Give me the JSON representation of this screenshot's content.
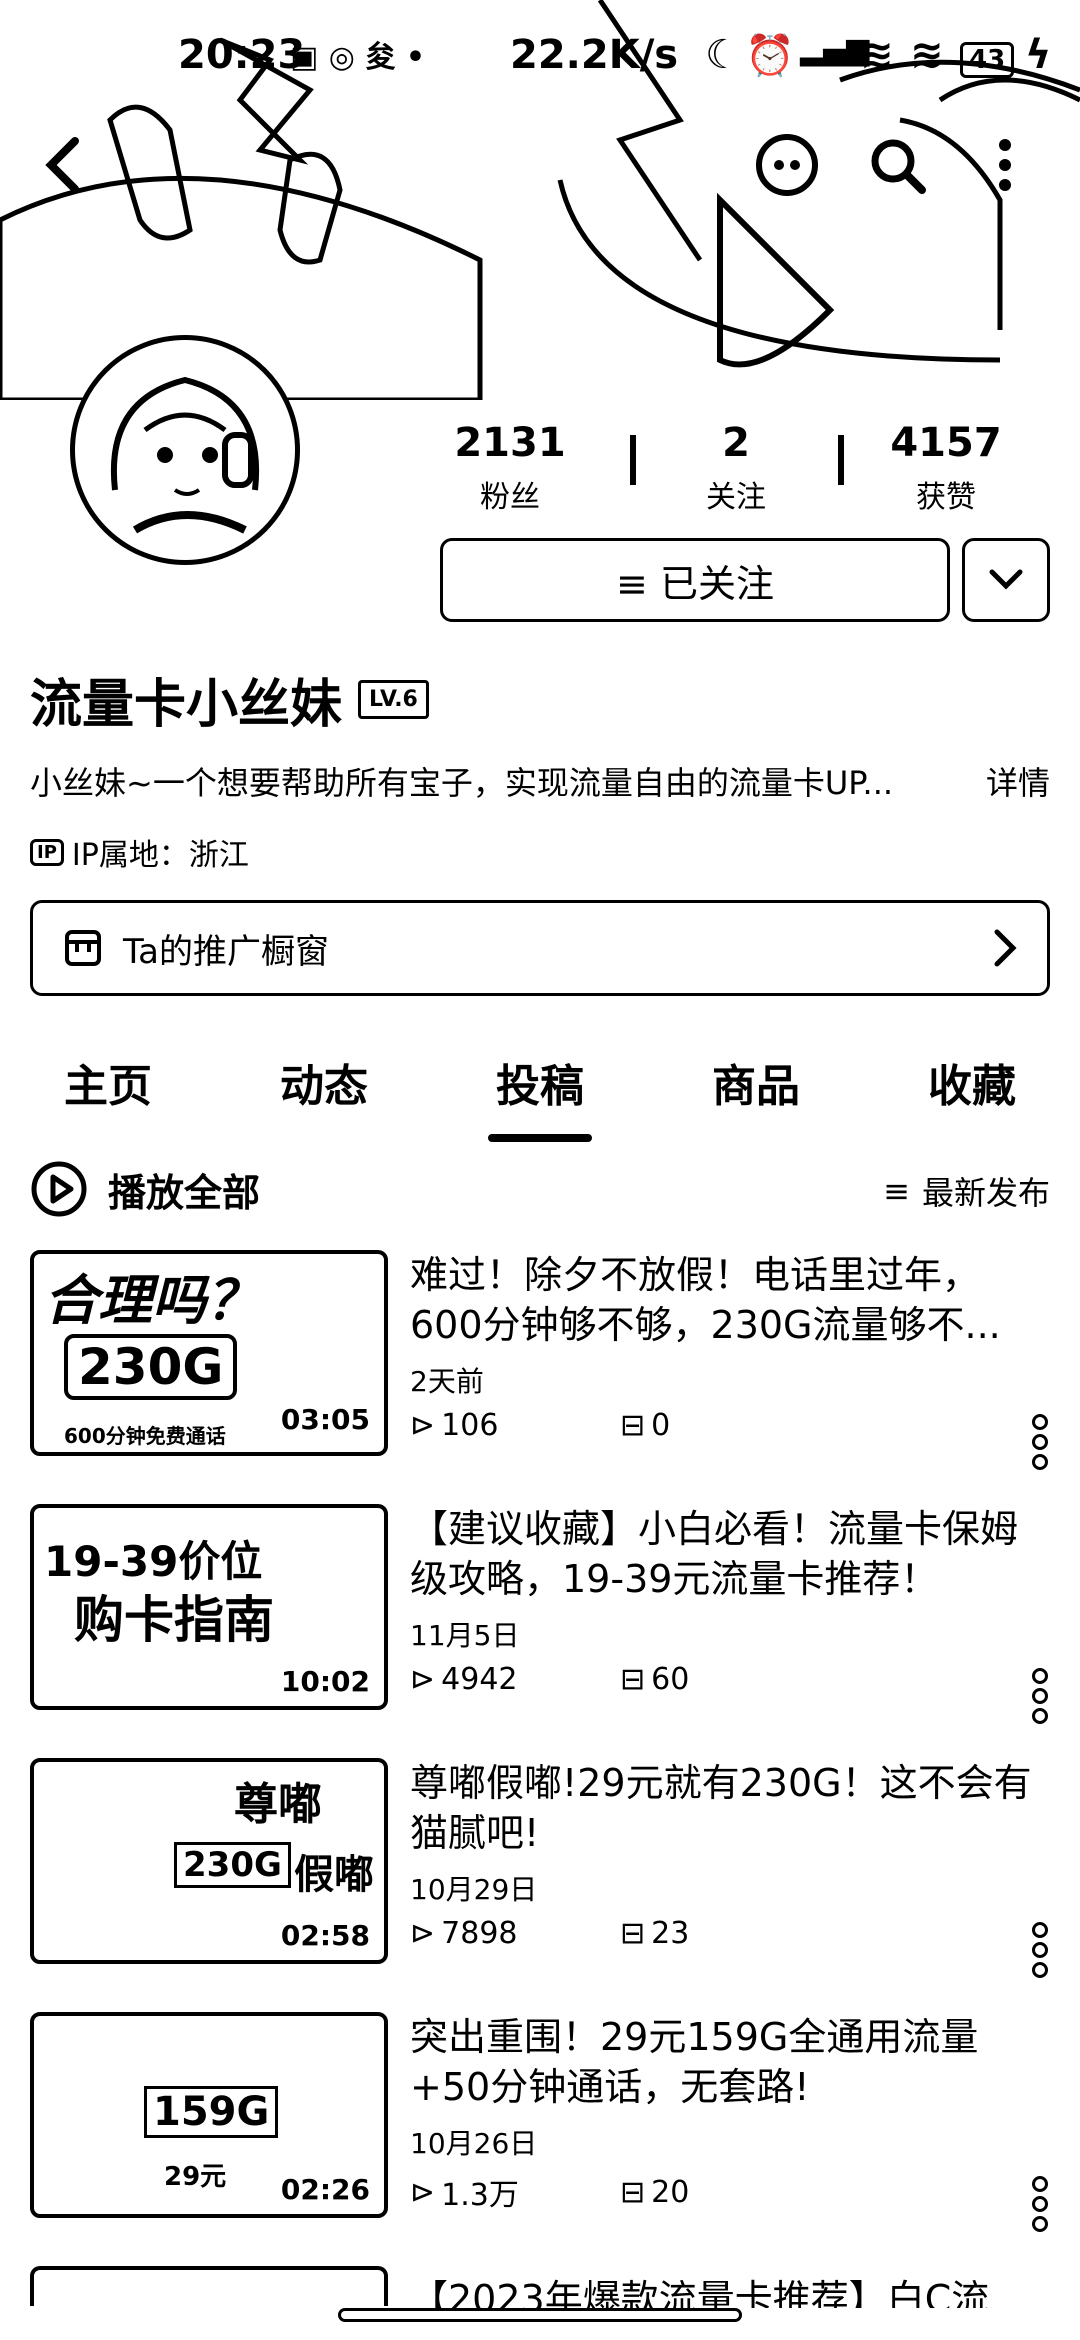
{
  "status_bar": {
    "time": "20:23",
    "network_speed": "22.2K/s",
    "battery": "43"
  },
  "profile": {
    "followers_count": "2131",
    "followers_label": "粉丝",
    "following_count": "2",
    "following_label": "关注",
    "likes_count": "4157",
    "likes_label": "获赞",
    "follow_button": "≡ 已关注",
    "name": "流量卡小丝妹",
    "level_badge": "LV.6",
    "bio": "小丝妹~一个想要帮助所有宝子，实现流量自由的流量卡UP...",
    "bio_more": "详情",
    "ip_location": "IP属地：浙江",
    "shop_label": "Ta的推广橱窗"
  },
  "tabs": [
    "主页",
    "动态",
    "投稿",
    "商品",
    "收藏"
  ],
  "active_tab": "投稿",
  "list_header": {
    "play_all": "播放全部",
    "sort": "最新发布"
  },
  "videos": [
    {
      "title": "难过！除夕不放假！电话里过年，600分钟够不够，230G流量够不...",
      "date": "2天前",
      "views": "106",
      "comments": "0",
      "duration": "03:05",
      "thumb_text_1": "合理吗？",
      "thumb_text_2": "230G",
      "thumb_text_3": "600分钟免费通话"
    },
    {
      "title": "【建议收藏】小白必看！流量卡保姆级攻略，19-39元流量卡推荐！",
      "date": "11月5日",
      "views": "4942",
      "comments": "60",
      "duration": "10:02",
      "thumb_text_1": "19-39价位",
      "thumb_text_2": "购卡指南",
      "thumb_text_3": ""
    },
    {
      "title": "尊嘟假嘟!29元就有230G！这不会有猫腻吧!",
      "date": "10月29日",
      "views": "7898",
      "comments": "23",
      "duration": "02:58",
      "thumb_text_1": "尊嘟",
      "thumb_text_2": "230G",
      "thumb_text_3": "假嘟"
    },
    {
      "title": "突出重围！29元159G全通用流量+50分钟通话，无套路!",
      "date": "10月26日",
      "views": "1.3万",
      "comments": "20",
      "duration": "02:26",
      "thumb_text_1": "159G",
      "thumb_text_2": "29元",
      "thumb_text_3": ""
    }
  ],
  "partial_next_title": "【2023年爆款流量卡推荐】白C流"
}
